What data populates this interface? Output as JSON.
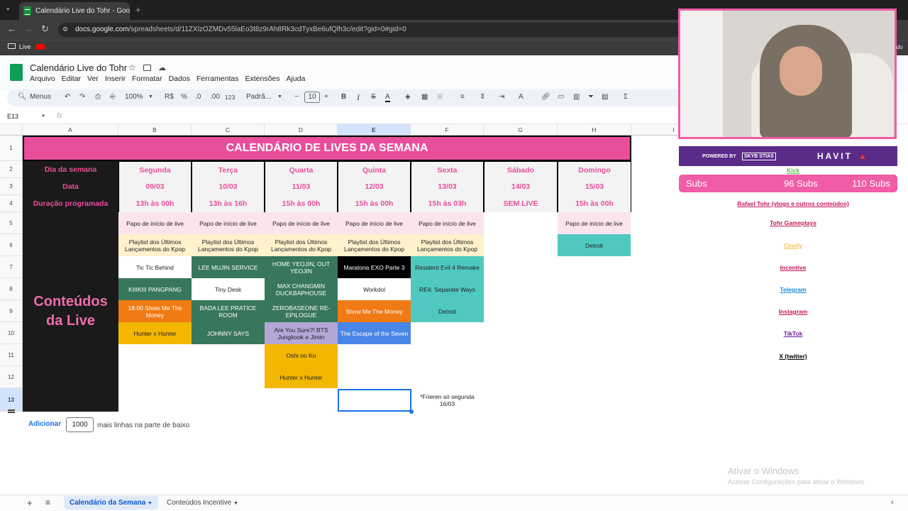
{
  "browser": {
    "tab_title": "Calendário Live do Tohr - Goog",
    "url_host": "docs.google.com",
    "url_path": "/spreadsheets/d/11ZXlzOZMDv55laEo3t8z9rAh8Rk3cdTyxBe6ufQlh3c/edit?gid=0#gid=0",
    "bookmark": "Live",
    "profile": "ido"
  },
  "doc": {
    "title": "Calendário Live do Tohr",
    "menu": [
      "Arquivo",
      "Editar",
      "Ver",
      "Inserir",
      "Formatar",
      "Dados",
      "Ferramentas",
      "Extensões",
      "Ajuda"
    ]
  },
  "toolbar": {
    "search": "Menus",
    "zoom": "100%",
    "currency": "R$",
    "percent": "%",
    "dec_less": ".0",
    "dec_more": ".00",
    "format123": "123",
    "font": "Padrã...",
    "font_size": "10"
  },
  "formula": {
    "cell_ref": "E13",
    "fx": "fx"
  },
  "columns": [
    "A",
    "B",
    "C",
    "D",
    "E",
    "F",
    "G",
    "H",
    "I"
  ],
  "rows": [
    "1",
    "2",
    "3",
    "4",
    "5",
    "6",
    "7",
    "8",
    "9",
    "10",
    "11",
    "12",
    "13"
  ],
  "sheet": {
    "title": "CALENDÁRIO DE LIVES DA SEMANA",
    "labels": {
      "day": "Dia da semana",
      "date": "Data",
      "duration": "Duração programada",
      "contents": "Conteúdos da Live"
    },
    "days": [
      "Segunda",
      "Terça",
      "Quarta",
      "Quinta",
      "Sexta",
      "Sábado",
      "Domingo"
    ],
    "dates": [
      "09/03",
      "10/03",
      "11/03",
      "12/03",
      "13/03",
      "14/03",
      "15/03"
    ],
    "durations": [
      "13h às 00h",
      "13h às 16h",
      "15h às 00h",
      "15h às 00h",
      "15h às 03h",
      "SEM LIVE",
      "15h às 00h"
    ],
    "r5": [
      "Papo de início de live",
      "Papo de início de live",
      "Papo de início de live",
      "Papo de início de live",
      "Papo de início de live",
      "",
      "Papo de início de live"
    ],
    "r6": [
      "Playlist dos Últimos Lançamentos do Kpop",
      "Playlist dos Últimos Lançamentos do Kpop",
      "Playlist dos Últimos Lançamentos do Kpop",
      "Playlist dos Últimos Lançamentos do Kpop",
      "Playlist dos Últimos Lançamentos do Kpop",
      "",
      "Detroit"
    ],
    "r7": [
      "Tic Tic Behind",
      "LEE MUJIN SERVICE",
      "HOME YEOJIN, OUT YEOJIN",
      "Maratona EXO Parte 3",
      "Resident Evil 4 Remake"
    ],
    "r8": [
      "KIIIKIII PANGPANG",
      "Tiny Desk",
      "MAX CHANGMIN DUCKBAPHOUSE",
      "Workdol",
      "RE4: Separate Ways"
    ],
    "r9": [
      "18:00 Show Me The Money",
      "BADA LEE PRATICE ROOM",
      "ZEROBASEONE RE-EPILOGUE",
      "Show Me The Money",
      "Detroit"
    ],
    "r10": [
      "Hunter x Hunter",
      "JOHNNY SAYS",
      "Are You Sure?! BTS Jungkook e Jimin",
      "The Escape of the Seven"
    ],
    "r11": "Oshi no Ko",
    "r12": "Hunter x Hunter",
    "note": "*Frieren só segunda 16/03"
  },
  "overlay": {
    "powered": "POWERED BY",
    "sponsor": "SKYB STIAS",
    "brand": "HAVIT",
    "subs_left": "Subs",
    "subs_count": "96 Subs",
    "subs_goal": "110 Subs",
    "links": [
      "Kick",
      "Rafael Tohr (vlogs e outros conteúdos)",
      "Tohr Gameplays",
      "Cinefy",
      "Incentive",
      "Telegram",
      "Instagram",
      "TikTok",
      "X (twitter)"
    ]
  },
  "footer": {
    "add": "Adicionar",
    "rows_value": "1000",
    "rows_text": "mais linhas na parte de baixo",
    "tabs": [
      "Calendário da Semana",
      "Conteúdos Incentive"
    ],
    "watermark1": "Ativar o Windows",
    "watermark2": "Acesse Configurações para ativar o Windows."
  }
}
